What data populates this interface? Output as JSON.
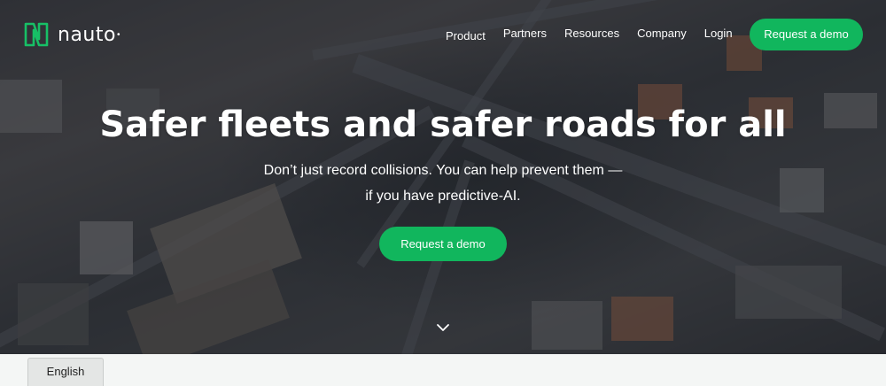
{
  "brand": {
    "name": "nauto",
    "accent": "#11b65d"
  },
  "nav": {
    "items": [
      "Product",
      "Partners",
      "Resources",
      "Company",
      "Login"
    ],
    "cta_label": "Request a demo"
  },
  "hero": {
    "headline": "Safer fleets and safer roads for all",
    "subtext_line1": "Don’t just record collisions. You can help prevent them —",
    "subtext_line2": "if you have predictive-AI.",
    "cta_label": "Request a demo",
    "scroll_icon": "chevron-down-icon"
  },
  "language": {
    "label": "English"
  }
}
